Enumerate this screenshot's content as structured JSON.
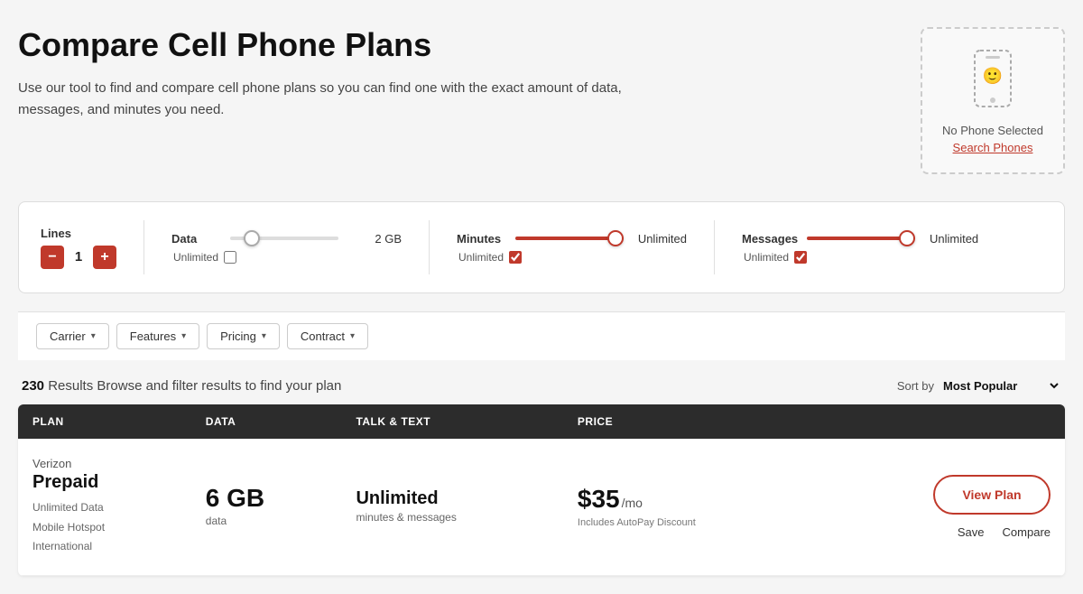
{
  "page": {
    "title": "Compare Cell Phone Plans",
    "subtitle": "Use our tool to find and compare cell phone plans so you can find one with the exact amount of data, messages, and minutes you need."
  },
  "phone_widget": {
    "no_phone_text": "No Phone Selected",
    "search_link": "Search Phones"
  },
  "filter_bar": {
    "lines_label": "Lines",
    "lines_value": "1",
    "data_label": "Data",
    "data_value": "2 GB",
    "data_unlimited_label": "Unlimited",
    "minutes_label": "Minutes",
    "minutes_value": "Unlimited",
    "minutes_unlimited_label": "Unlimited",
    "messages_label": "Messages",
    "messages_value": "Unlimited",
    "messages_unlimited_label": "Unlimited"
  },
  "dropdown_filters": [
    {
      "label": "Carrier"
    },
    {
      "label": "Features"
    },
    {
      "label": "Pricing"
    },
    {
      "label": "Contract"
    }
  ],
  "results": {
    "count": "230",
    "count_label": "Results",
    "browse_text": "Browse and filter results to find your plan",
    "sort_label": "Sort by",
    "sort_value": "Most Popular"
  },
  "table": {
    "headers": [
      {
        "key": "plan",
        "label": "PLAN"
      },
      {
        "key": "data",
        "label": "DATA"
      },
      {
        "key": "talk",
        "label": "TALK & TEXT"
      },
      {
        "key": "price",
        "label": "PRICE"
      },
      {
        "key": "actions",
        "label": ""
      }
    ],
    "rows": [
      {
        "carrier": "Verizon",
        "plan_name": "Prepaid",
        "features": [
          "Unlimited Data",
          "Mobile Hotspot",
          "International"
        ],
        "data_amount": "6 GB",
        "data_label": "data",
        "talk_value": "Unlimited",
        "talk_sub": "minutes & messages",
        "price_dollar": "$35",
        "price_mo": "/mo",
        "price_note": "Includes AutoPay Discount",
        "view_plan_label": "View Plan",
        "save_label": "Save",
        "compare_label": "Compare"
      }
    ]
  }
}
